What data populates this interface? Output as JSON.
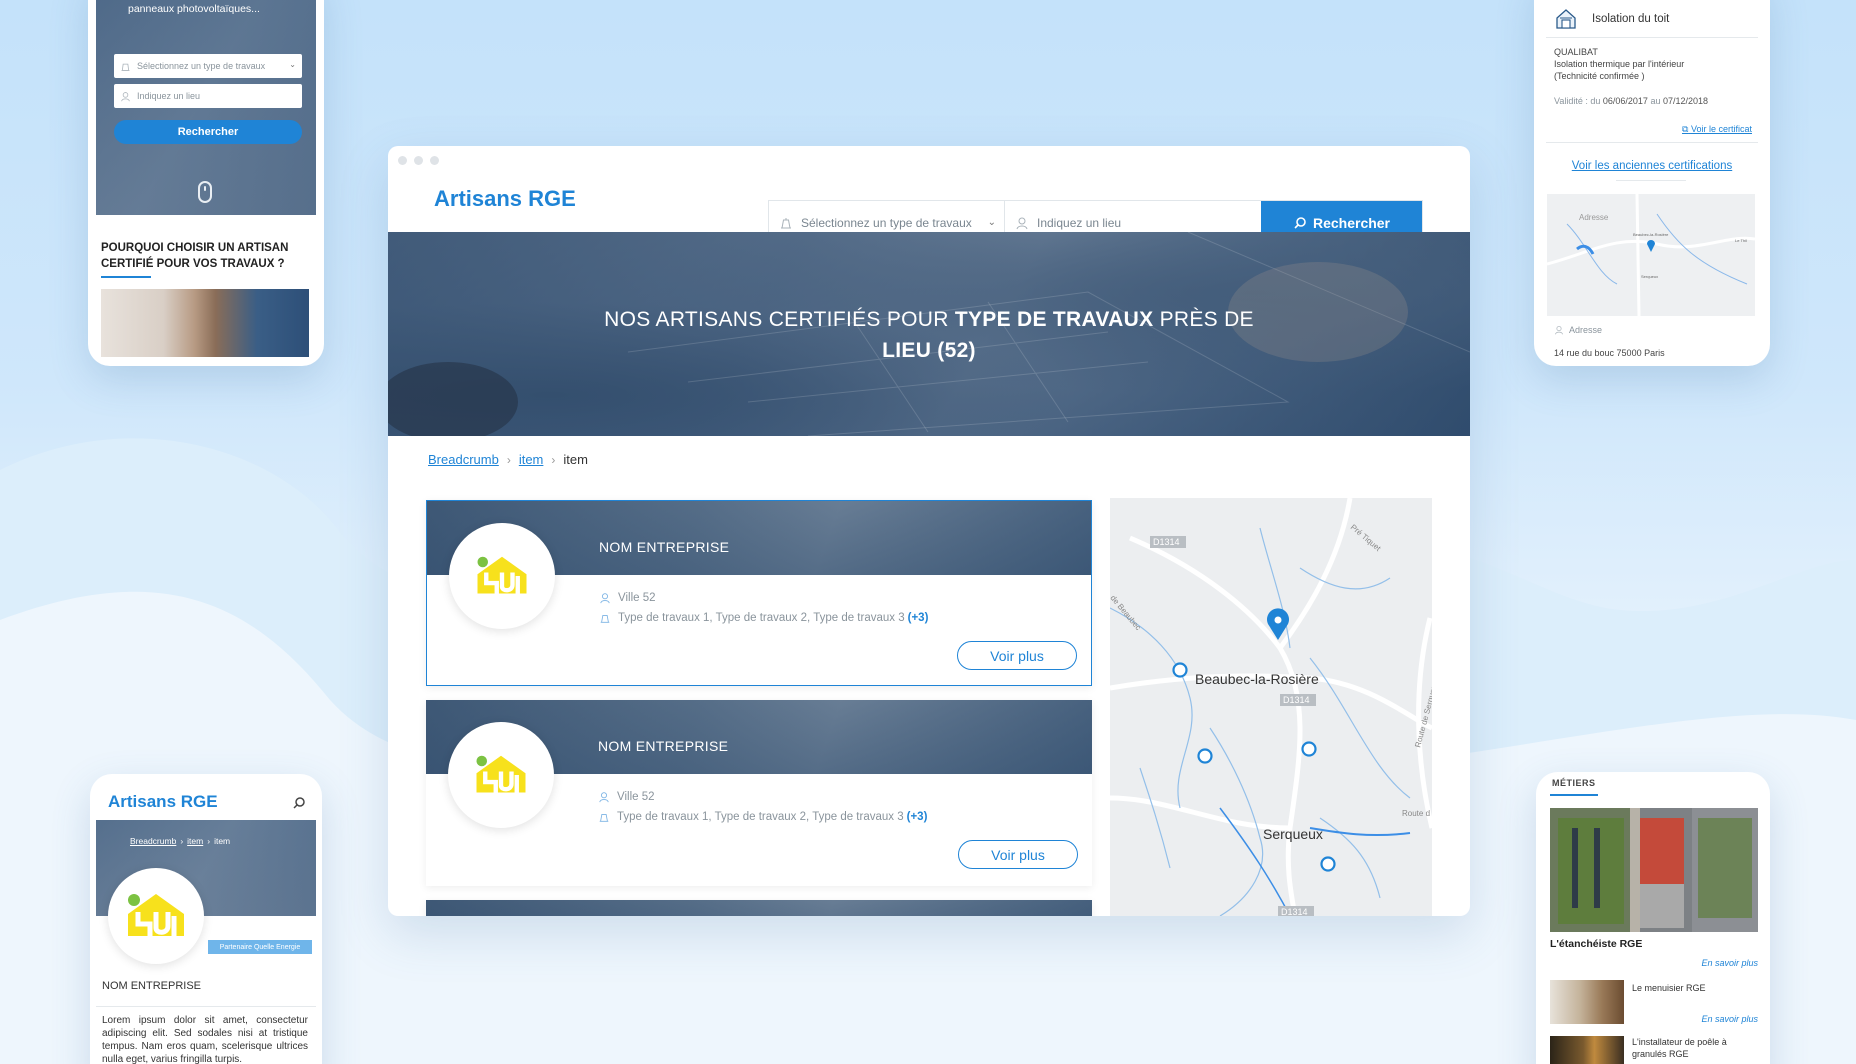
{
  "colors": {
    "accent": "#1f84d6",
    "badge": "#6fb5ea",
    "background": "#cfe7fb"
  },
  "desktop": {
    "logo": "Artisans RGE",
    "search": {
      "type_placeholder": "Sélectionnez un type de travaux",
      "place_placeholder": "Indiquez un lieu",
      "button_label": "Rechercher"
    },
    "hero": {
      "prefix": "NOS ARTISANS CERTIFIÉS POUR",
      "type": "TYPE DE TRAVAUX",
      "middle": "PRÈS DE",
      "place": "LIEU (52)"
    },
    "breadcrumb": [
      {
        "label": "Breadcrumb",
        "link": true
      },
      {
        "label": "item",
        "link": true
      },
      {
        "label": "item",
        "link": false
      }
    ],
    "results": [
      {
        "name": "NOM ENTREPRISE",
        "city": "Ville 52",
        "types": "Type de travaux 1, Type de travaux 2, Type de travaux 3",
        "more": "(+3)",
        "button": "Voir plus"
      },
      {
        "name": "NOM ENTREPRISE",
        "city": "Ville 52",
        "types": "Type de travaux 1, Type de travaux 2, Type de travaux 3",
        "more": "(+3)",
        "button": "Voir plus"
      }
    ],
    "map": {
      "road_labels": [
        "D1314",
        "D1314",
        "D1314"
      ],
      "places": [
        "Beaubec-la-Rosière",
        "Serqueux"
      ],
      "side_labels": [
        "Pré Tiquet",
        "de Beaubec",
        "Route de Serqueux",
        "Route d"
      ]
    }
  },
  "phone_search": {
    "intro": "panneaux photovoltaïques...",
    "type_placeholder": "Sélectionnez un type de travaux",
    "place_placeholder": "Indiquez un lieu",
    "button_label": "Rechercher",
    "heading": "POURQUOI CHOISIR UN ARTISAN CERTIFIÉ POUR VOS TRAVAUX ?"
  },
  "phone_certif": {
    "title": "Isolation du toit",
    "org": "QUALIBAT",
    "desc_line1": "Isolation thermique par l'intérieur",
    "desc_line2": "(Technicité confirmée )",
    "validity_prefix": "Validité : du",
    "date_from": "06/06/2017",
    "validity_mid": "au",
    "date_to": "07/12/2018",
    "cert_link": "Voir le certificat",
    "old_link": "Voir les anciennes certifications",
    "map_address_label": "Adresse",
    "map_labels": [
      "Adresse",
      "Beaubec-la-Rosière",
      "Serqueux",
      "Le Thil"
    ],
    "address_label": "Adresse",
    "address": "14 rue du bouc 75000 Paris"
  },
  "phone_profile": {
    "logo": "Artisans RGE",
    "breadcrumb": [
      "Breadcrumb",
      "item",
      "item"
    ],
    "badge": "Partenaire Quelle Energie",
    "company": "NOM ENTREPRISE",
    "lorem": "Lorem ipsum dolor sit amet, consectetur adipiscing elit. Sed sodales nisi at tristique tempus. Nam eros quam, scelerisque ultrices nulla eget, varius fringilla turpis."
  },
  "phone_trades": {
    "section_label": "MÉTIERS",
    "featured_title": "L'étanchéiste RGE",
    "more_label": "En savoir plus",
    "item1": "Le menuisier RGE",
    "item2_line1": "L'installateur de poêle à",
    "item2_line2": "granulés RGE"
  }
}
